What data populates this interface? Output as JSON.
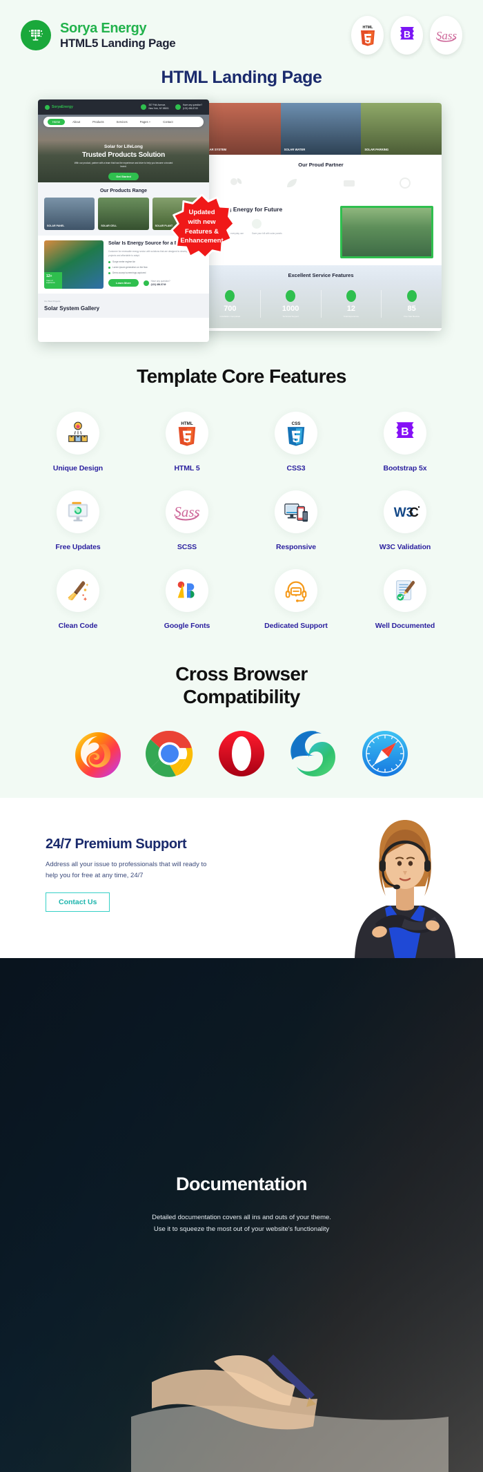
{
  "header": {
    "logo_icon": "solar-panel-icon",
    "brand_name": "Sorya Energy",
    "brand_subtitle": "HTML5 Landing Page",
    "tech_badges": [
      {
        "name": "html5-badge",
        "label": "HTML5"
      },
      {
        "name": "bootstrap-badge",
        "label": "Bootstrap"
      },
      {
        "name": "sass-badge",
        "label": "Sass"
      }
    ]
  },
  "preview": {
    "title": "HTML Landing Page",
    "badge": {
      "line1": "Updated",
      "line2": "with new",
      "line3": "Features &",
      "line4": "Enhancement",
      "color": "#f01919"
    },
    "mockup_left": {
      "logo": "SoryaEnergy",
      "contact1_line1": "357 Polk Avenue,",
      "contact1_line2": "New York, NY 85001",
      "contact2_line1": "Have any question?",
      "contact2_line2": "(123) 456-5749",
      "nav": [
        "Home",
        "About",
        "Products",
        "Services",
        "Pages +",
        "Contact"
      ],
      "hero_small": "Solar for LifeLong",
      "hero_large": "Trusted Products Solution",
      "hero_paragraph": "With our product, partner with a team that has the experience and drive to help you become a trusted brand.",
      "hero_button": "Get Started",
      "products_title": "Our Products Range",
      "product_cards": [
        "SOLAR PANEL",
        "SOLAR CELL",
        "SOLAR PLANT"
      ],
      "about_heading": "Solar Is Energy Source for a Better Life",
      "about_paragraph": "Customer for renewable energy sector with solutions that are designed to develop professional projects and affordable to adapt.",
      "about_list": [
        "Surge meter regime kin",
        "Lorem ipsum generation on the flow",
        "Demo accept screenings captured"
      ],
      "about_button": "Learn More",
      "about_phone_label": "Have any question?",
      "about_phone": "(123) 456-5749",
      "badge_years": "12+",
      "badge_years_label": "Years of experience",
      "gallery_small": "Our Best Projects",
      "gallery_title": "Solar System Gallery"
    },
    "mockup_right": {
      "strip_captions": [
        "SOLAR SYSTEM",
        "SOLAR WATER",
        "SOLAR PARKING"
      ],
      "partner_title": "Our Proud Partner",
      "shaping_title": "Shaping Energy for Future",
      "stats_title": "Excellent Service Features",
      "stats": [
        {
          "value": "700",
          "label": "Installation Completed"
        },
        {
          "value": "1000",
          "label": "Technical Support"
        },
        {
          "value": "12",
          "label": "Total Experience"
        },
        {
          "value": "85",
          "label": "Five Star Review"
        }
      ]
    }
  },
  "core_features": {
    "title": "Template Core Features",
    "items": [
      {
        "label": "Unique Design",
        "icon": "award-box-icon"
      },
      {
        "label": "HTML 5",
        "icon": "html5-icon"
      },
      {
        "label": "CSS3",
        "icon": "css3-icon"
      },
      {
        "label": "Bootstrap 5x",
        "icon": "bootstrap-icon"
      },
      {
        "label": "Free Updates",
        "icon": "monitor-refresh-icon"
      },
      {
        "label": "SCSS",
        "icon": "sass-icon"
      },
      {
        "label": "Responsive",
        "icon": "devices-icon"
      },
      {
        "label": "W3C Validation",
        "icon": "w3c-icon"
      },
      {
        "label": "Clean Code",
        "icon": "paint-brush-icon"
      },
      {
        "label": "Google Fonts",
        "icon": "google-fonts-icon"
      },
      {
        "label": "Dedicated Support",
        "icon": "headset-icon"
      },
      {
        "label": "Well Documented",
        "icon": "document-check-icon"
      }
    ],
    "label_color": "#2a1f9e"
  },
  "browsers": {
    "title_line1": "Cross Browser",
    "title_line2": "Compatibility",
    "items": [
      {
        "name": "firefox-icon",
        "label": "Firefox"
      },
      {
        "name": "chrome-icon",
        "label": "Chrome"
      },
      {
        "name": "opera-icon",
        "label": "Opera"
      },
      {
        "name": "edge-icon",
        "label": "Microsoft Edge"
      },
      {
        "name": "safari-icon",
        "label": "Safari"
      }
    ]
  },
  "support": {
    "heading": "24/7 Premium Support",
    "paragraph": "Address all your issue to professionals that will ready to help you for free at any time, 24/7",
    "button_label": "Contact Us",
    "button_color": "#35d0c6",
    "heading_color": "#1a2a6c",
    "image": "support-agent-photo"
  },
  "documentation": {
    "heading": "Documentation",
    "line1": "Detailed documentation covers all ins and outs of your theme.",
    "line2": "Use it to squeeze the most out of your website's functionality"
  }
}
